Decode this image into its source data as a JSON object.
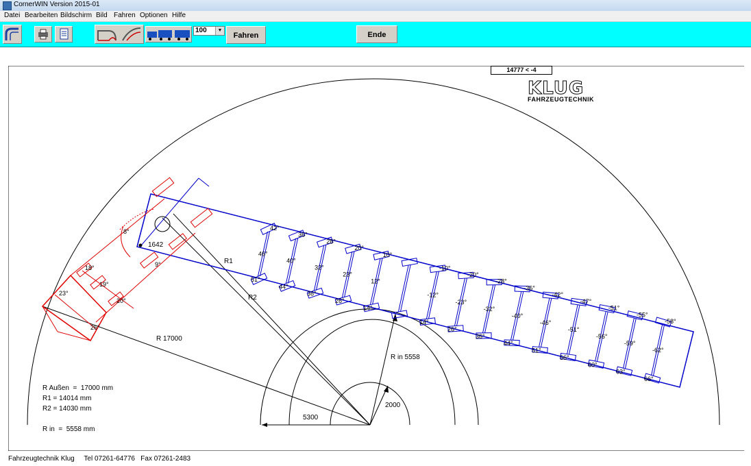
{
  "window": {
    "title": "CornerWIN  Version 2015-01"
  },
  "menu": [
    "Datei",
    "Bearbeiten",
    "Bildschirm",
    "Bild",
    "Fahren",
    "Optionen",
    "Hilfe"
  ],
  "toolbar": {
    "speed_value": "100",
    "fahren_label": "Fahren",
    "ende_label": "Ende",
    "icons": [
      "app-curve-icon",
      "printer-icon",
      "document-icon",
      "road-curve-icon",
      "truck-trailer-icon"
    ]
  },
  "readout": "14777 < -4",
  "logo": {
    "brand": "KLUG",
    "subtitle": "FAHRZEUGTECHNIK"
  },
  "drawing": {
    "label_R1": "R1",
    "label_R2": "R2",
    "label_R17000": "R  17000",
    "label_Rin": "R in  5558",
    "label_5300": "5300",
    "label_2000": "2000",
    "label_1642": "1642",
    "angles_red": [
      "18°",
      "19°",
      "20°",
      "23°",
      "26°",
      "8°",
      "9°"
    ],
    "angles_top": [
      "42°",
      "36°",
      "28°",
      "20°",
      "10°",
      "",
      "-10°",
      "-20°",
      "-28°",
      "-36°",
      "-42°",
      "-47°",
      "-51°",
      "-55°",
      "-58°"
    ],
    "angles_mid": [
      "46°",
      "40°",
      "32°",
      "23°",
      "12°",
      "",
      "-12°",
      "-23°",
      "-32°",
      "-40°",
      "-46°",
      "-51°",
      "-56°",
      "-59°",
      "-62°"
    ],
    "angles_bot": [
      "51°",
      "44°",
      "36°",
      "26°",
      "14°",
      "",
      "14°",
      "26°",
      "36°",
      "44°",
      "51°",
      "56°",
      "60°",
      "63°",
      "66°"
    ],
    "colors": {
      "trailer": "#0000cc",
      "tractor": "#e00000",
      "lines": "#000000"
    }
  },
  "info": {
    "line1": "R Außen  =  17000 mm",
    "line2": "R1 = 14014 mm",
    "line3": "R2 = 14030 mm",
    "line4": "R in  =  5558 mm"
  },
  "footer": "Fahrzeugtechnik Klug     Tel 07261-64776   Fax 07261-2483"
}
